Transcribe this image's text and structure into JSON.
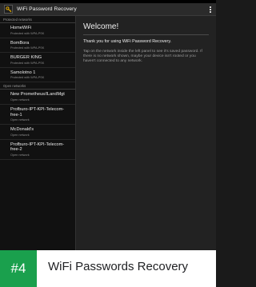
{
  "app": {
    "title": "WiFi Password Recovery"
  },
  "sections": [
    {
      "header": "Protected networks",
      "items": [
        {
          "name": "HomeWiFi",
          "sub": "Protected with WPA-PSK"
        },
        {
          "name": "BomBora",
          "sub": "Protected with WPA-PSK"
        },
        {
          "name": "BURGER KING",
          "sub": "Protected with WPA-PSK"
        },
        {
          "name": "Samolotno 1",
          "sub": "Protected with WPA-PSK"
        }
      ]
    },
    {
      "header": "Open networks",
      "items": [
        {
          "name": "New Prometheus/ILandMgt",
          "sub": "Open network"
        },
        {
          "name": "Profburo-IPT-KPI-Telecom-free-1",
          "sub": "Open network"
        },
        {
          "name": "McDonald's",
          "sub": "Open network"
        },
        {
          "name": "Profburo-IPT-KPI-Telecom-free-2",
          "sub": "Open network"
        }
      ]
    }
  ],
  "welcome": {
    "title": "Welcome!",
    "thanks": "Thank you for using WiFi Password Recovery.",
    "body": "Tap on the network inside the left panel to see it's saved password. If there is no network shown, maybe your device isn't rooted or you haven't connected to any network."
  },
  "banner": {
    "rank": "#4",
    "title": "WiFi Passwords Recovery",
    "rank_color": "#1aa04d"
  },
  "icons": {
    "app": "key-icon",
    "menu": "overflow-menu-icon"
  }
}
